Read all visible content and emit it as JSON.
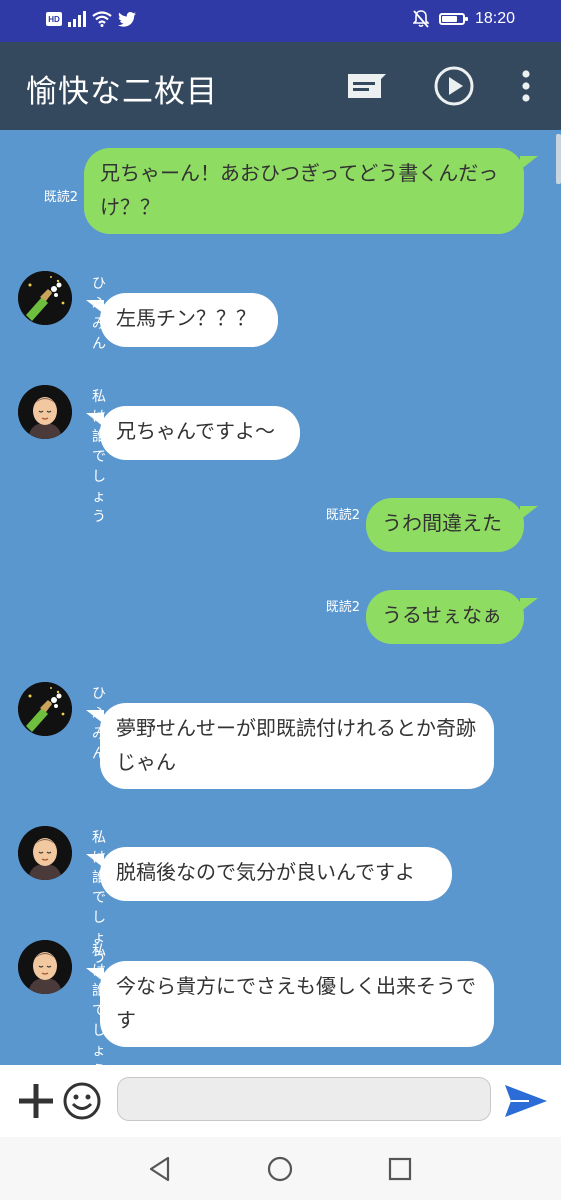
{
  "status_bar": {
    "badge": "HD",
    "time": "18:20",
    "battery_level": 0.75
  },
  "app_bar": {
    "title": "愉快な二枚目"
  },
  "messages": [
    {
      "side": "right",
      "text": "兄ちゃーん！あおひつぎってどう書くんだっけ？？",
      "read": "既読2"
    },
    {
      "side": "left",
      "sender": "ひふみん",
      "avatar": "champagne-avatar",
      "text": "左馬チン？？？"
    },
    {
      "side": "left",
      "sender": "私は誰でしょう",
      "avatar": "monk-avatar",
      "text": "兄ちゃんですよ〜"
    },
    {
      "side": "right",
      "text": "うわ間違えた",
      "read": "既読2"
    },
    {
      "side": "right",
      "text": "うるせぇなぁ",
      "read": "既読2"
    },
    {
      "side": "left",
      "sender": "ひふみん",
      "avatar": "champagne-avatar",
      "text": "夢野せんせーが即既読付けれるとか奇跡じゃん"
    },
    {
      "side": "left",
      "sender": "私は誰でしょう",
      "avatar": "monk-avatar",
      "text": "脱稿後なので気分が良いんですよ"
    },
    {
      "side": "left",
      "sender": "私は誰でしょう",
      "avatar": "monk-avatar",
      "text": "今なら貴方にでさえも優しく出来そうです"
    }
  ],
  "input_bar": {
    "value": "",
    "placeholder": ""
  },
  "colors": {
    "status_bar": "#2f3aa6",
    "app_bar": "#34495e",
    "chat_background": "#5b97cf",
    "own_bubble": "#8fdc63",
    "other_bubble": "#ffffff",
    "send_icon": "#2b6cd6"
  },
  "icons": {
    "status_left": [
      "hd-badge",
      "signal-icon",
      "wifi-icon",
      "twitter-icon"
    ],
    "status_right": [
      "notifications-off-icon",
      "battery-icon"
    ],
    "app_bar": [
      "message-icon",
      "play-circle-icon",
      "more-vert-icon"
    ],
    "input_bar": [
      "plus-icon",
      "smiley-icon",
      "send-icon"
    ],
    "nav_bar": [
      "back-icon",
      "home-icon",
      "recents-icon"
    ]
  }
}
